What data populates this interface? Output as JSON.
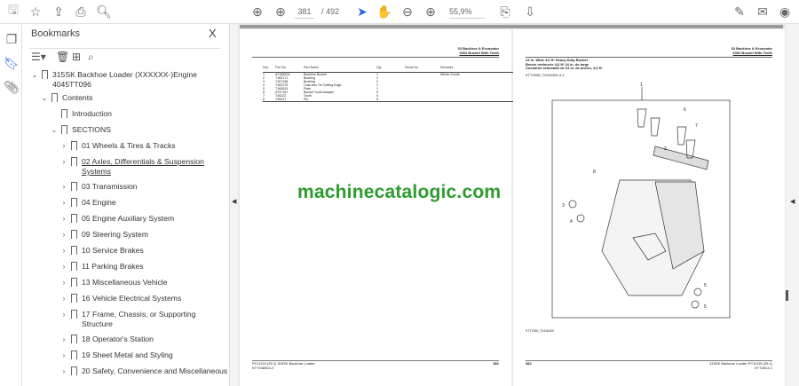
{
  "toolbar": {
    "page_current": "381",
    "page_total": "/ 492",
    "zoom": "55,9%",
    "zoom_caret": "▾"
  },
  "panel": {
    "title": "Bookmarks",
    "close": "X"
  },
  "bookmarks": [
    {
      "label": "315SK Backhoe Loader (XXXXXX-)Engine",
      "level": 0,
      "twisty": "⌄"
    },
    {
      "label": "4045TT096",
      "level": 0,
      "cont": true
    },
    {
      "label": "Contents",
      "level": 1,
      "twisty": "⌄"
    },
    {
      "label": "Introduction",
      "level": 2
    },
    {
      "label": "SECTIONS",
      "level": 2,
      "twisty": "⌄"
    },
    {
      "label": "01 Wheels & Tires & Tracks",
      "level": 3,
      "twisty": "›"
    },
    {
      "label": "02 Axles, Differentials & Suspension",
      "level": 3,
      "twisty": "›",
      "underline": true
    },
    {
      "label": "Systems",
      "level": 3,
      "cont": true,
      "underline": true
    },
    {
      "label": "03 Transmission",
      "level": 3,
      "twisty": "›"
    },
    {
      "label": "04 Engine",
      "level": 3,
      "twisty": "›"
    },
    {
      "label": "05 Engine Auxiliary System",
      "level": 3,
      "twisty": "›"
    },
    {
      "label": "09 Steering System",
      "level": 3,
      "twisty": "›"
    },
    {
      "label": "10 Service Brakes",
      "level": 3,
      "twisty": "›"
    },
    {
      "label": "11 Parking Brakes",
      "level": 3,
      "twisty": "›"
    },
    {
      "label": "13 Miscellaneous Vehicle",
      "level": 3,
      "twisty": "›"
    },
    {
      "label": "16 Vehicle Electrical Systems",
      "level": 3,
      "twisty": "›"
    },
    {
      "label": "17 Frame, Chassis, or Supporting",
      "level": 3,
      "twisty": "›"
    },
    {
      "label": "Structure",
      "level": 3,
      "cont": true
    },
    {
      "label": "18 Operator's Station",
      "level": 3,
      "twisty": "›"
    },
    {
      "label": "19 Sheet Metal and Styling",
      "level": 3,
      "twisty": "›"
    },
    {
      "label": "20 Safety, Convenience and Miscellaneous",
      "level": 3,
      "twisty": "›"
    }
  ],
  "left_page": {
    "header": [
      "33 Backhoe & Excavator",
      "3302 Bucket With Teeth"
    ],
    "columns": [
      "Key",
      "Part No.",
      "Part Name",
      "Qty",
      "Serial No.",
      "Remarks"
    ],
    "rows": [
      [
        "1",
        "AT186526",
        "Backhoe Bucket",
        "1",
        "",
        "Whole Goods"
      ],
      [
        "2",
        "T182171",
        "Bushing",
        "2",
        "",
        ""
      ],
      [
        "3",
        "T167156",
        "Bushing",
        "2",
        "",
        ""
      ],
      [
        "4",
        "T162276",
        "Cast-less Tie Cutting Edge",
        "1",
        "",
        ""
      ],
      [
        "5",
        "T162629",
        "Plate",
        "1",
        "",
        ""
      ],
      [
        "6",
        "AT47167",
        "Bucket Tooth Adapter",
        "5",
        "",
        ""
      ],
      [
        "7",
        "T45222",
        "Tooth",
        "5",
        "",
        ""
      ],
      [
        "8",
        "T45427",
        "Pin",
        "5",
        "",
        ""
      ]
    ],
    "footer_left": "PC11116 (25.1) 315SK Backhoe Loader",
    "footer_sub": "KTT048604-2",
    "page_no": "381"
  },
  "right_page": {
    "header": [
      "33 Backhoe & Excavator",
      "3302 Bucket With Teeth"
    ],
    "title_lines": [
      "24 in. Wide 4.6 ft³ Heavy Duty Bucket",
      "Benne renforcée 4,6 ft³ 24 in. de large",
      "Cucharón reforzado de 24 in. de ancho, 4,6 ft³"
    ],
    "ref": "KTT4008_T0116400-4-1",
    "figure_ref": "KTT7480_T0116400",
    "callouts": [
      "1",
      "2",
      "3",
      "4",
      "5",
      "6",
      "7",
      "8",
      "3",
      "4",
      "5",
      "6"
    ],
    "page_no": "382",
    "footer_right": "315SK Backhoe Loader PC11116 (25.1)",
    "footer_sub": "KTT4813-1"
  },
  "watermark": "machinecatalogic.com",
  "colors": {
    "watermark": "#2d9b2d",
    "cursor": "#2a6ad8"
  }
}
